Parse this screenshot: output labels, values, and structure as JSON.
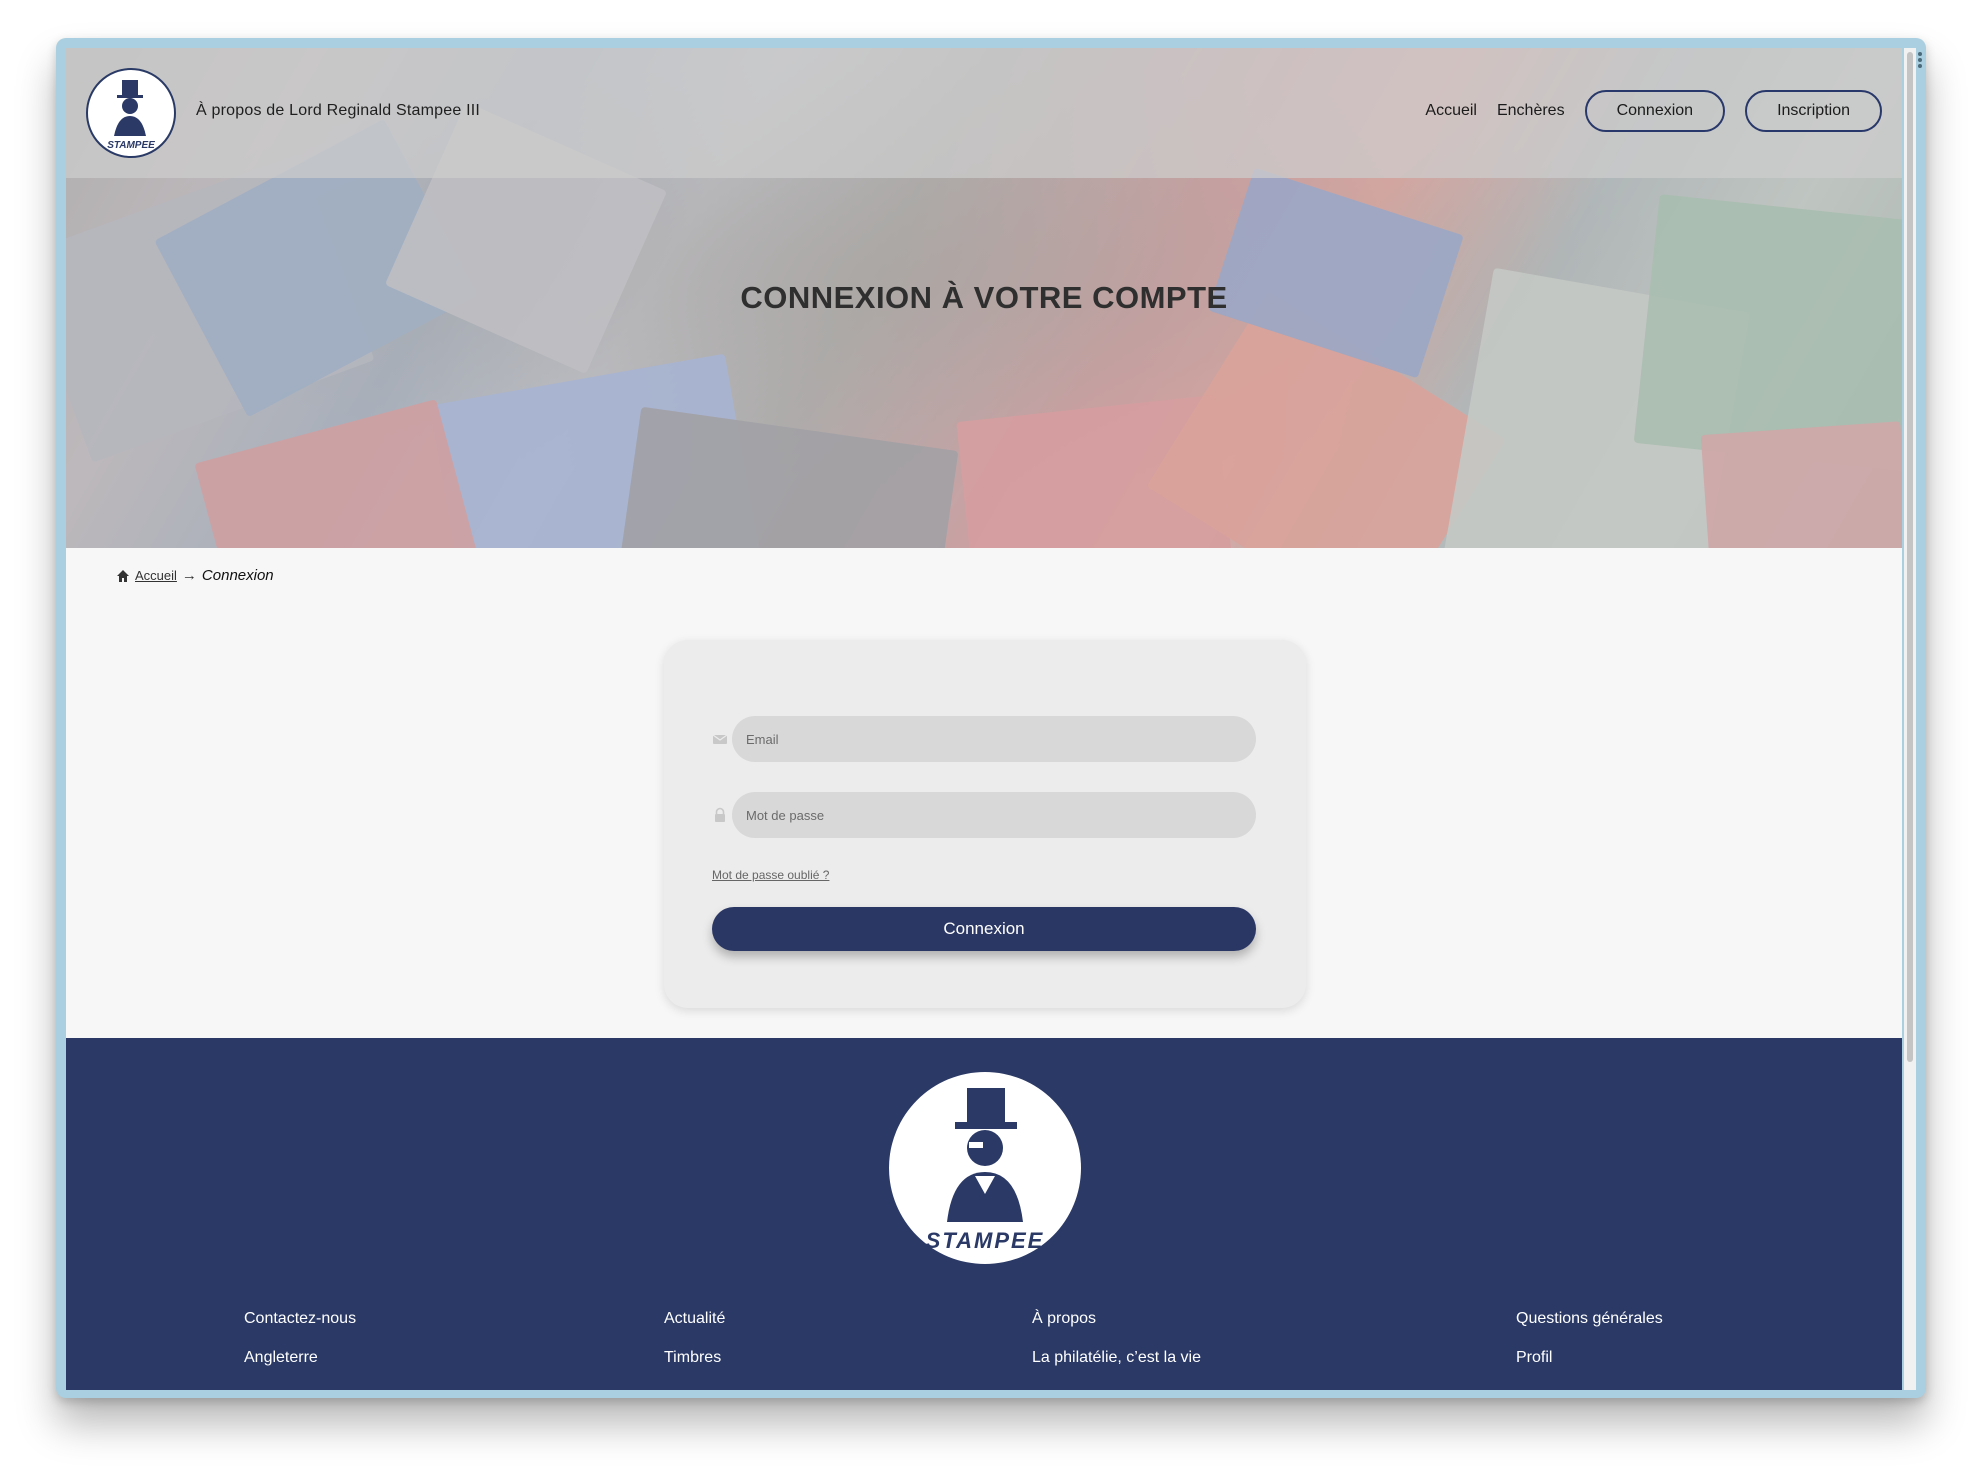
{
  "header": {
    "brand_text": "À propos de Lord Reginald Stampee III",
    "nav": {
      "home": "Accueil",
      "auctions": "Enchères",
      "login": "Connexion",
      "signup": "Inscription"
    },
    "logo_text": "STAMPEE"
  },
  "hero": {
    "title": "CONNEXION À VOTRE COMPTE"
  },
  "breadcrumb": {
    "home": "Accueil",
    "current": "Connexion"
  },
  "login_form": {
    "email_placeholder": "Email",
    "password_placeholder": "Mot de passe",
    "forgot_password": "Mot de passe oublié ?",
    "submit_label": "Connexion"
  },
  "footer": {
    "logo_text": "STAMPEE",
    "columns": [
      {
        "items": [
          "Contactez-nous",
          "Angleterre"
        ]
      },
      {
        "items": [
          "Actualité",
          "Timbres"
        ]
      },
      {
        "items": [
          "À propos",
          "La philatélie, c’est la vie"
        ]
      },
      {
        "items": [
          "Questions générales",
          "Profil"
        ]
      }
    ]
  },
  "colors": {
    "primary": "#2a3966",
    "button": "#2a3764",
    "page_background": "#f7f7f7",
    "card_background": "#ececec",
    "field_background": "#d8d8d8"
  }
}
